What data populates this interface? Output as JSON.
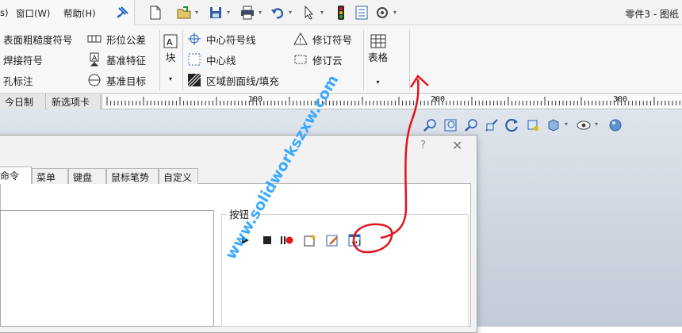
{
  "menu": {
    "window_label": "窗口(W)",
    "help_label": "帮助(H)"
  },
  "title": "零件3 - 图纸",
  "quick_toolbar_icons": [
    "pin-icon",
    "new-document-icon",
    "open-icon",
    "save-icon",
    "print-icon",
    "undo-icon",
    "select-icon",
    "traffic-light-icon",
    "file-properties-icon",
    "options-gear-icon"
  ],
  "ribbon": {
    "col1": [
      "表面粗糙度符号",
      "焊接符号",
      "孔标注"
    ],
    "col2": [
      "形位公差",
      "基准特征",
      "基准目标"
    ],
    "block_label": "块",
    "col3": [
      "中心符号线",
      "中心线",
      "区域剖面线/填充"
    ],
    "col4": [
      "修订符号",
      "修订云"
    ],
    "table_label": "表格"
  },
  "command_tabs": [
    "今日制造",
    "新选项卡"
  ],
  "ruler": {
    "labels": [
      "100",
      "200",
      "300"
    ]
  },
  "dialog": {
    "help": "?",
    "close": "✕",
    "tabs": [
      "命令",
      "菜单",
      "键盘",
      "鼠标笔势",
      "自定义"
    ],
    "active_tab": "命令",
    "buttons_group_label": "按钮",
    "macro_buttons": [
      "run-icon",
      "stop-icon",
      "pause-record-icon",
      "new-macro-icon",
      "edit-macro-icon",
      "custom-macro-icon"
    ]
  },
  "watermark": "www.solidworkszxw.com",
  "colors": {
    "annotation": "#e0141b",
    "watermark": "#2aa3ff",
    "accent": "#1f5fbf"
  }
}
